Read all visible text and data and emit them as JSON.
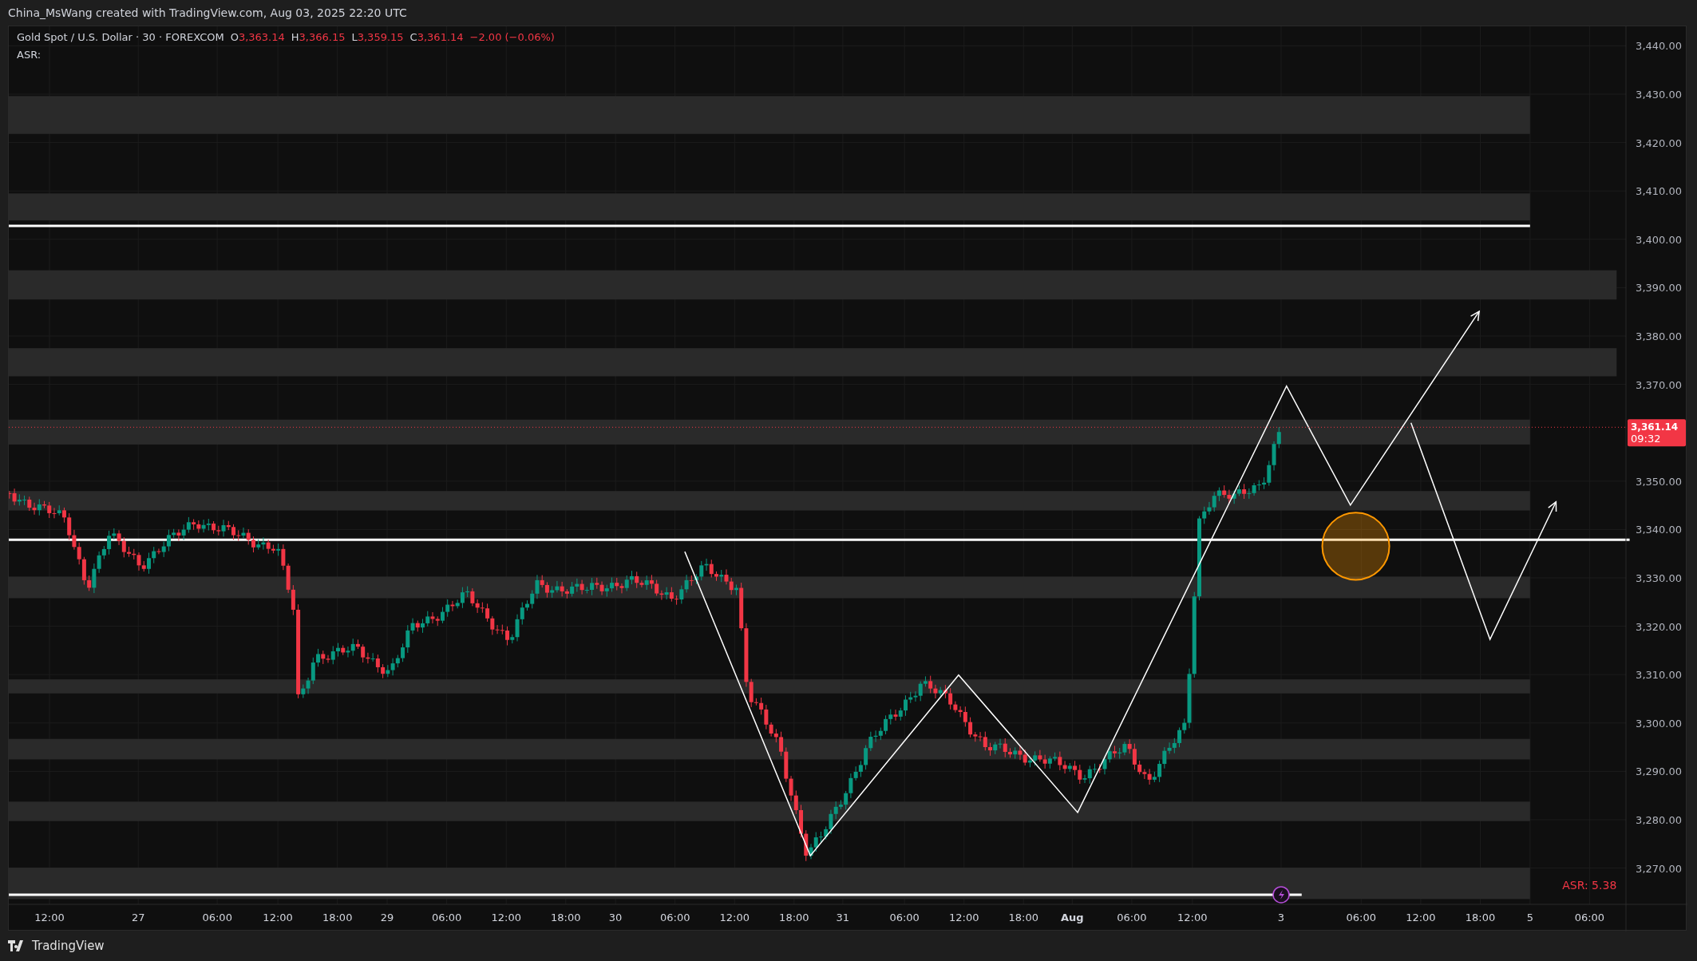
{
  "header": {
    "credit": "China_MsWang created with TradingView.com, Aug 03, 2025 22:20 UTC"
  },
  "legend": {
    "symbol": "Gold Spot / U.S. Dollar · 30 · FOREXCOM",
    "ohlc": [
      {
        "label": "O",
        "value": "3,363.14"
      },
      {
        "label": "H",
        "value": "3,366.15"
      },
      {
        "label": "L",
        "value": "3,359.15"
      },
      {
        "label": "C",
        "value": "3,361.14"
      }
    ],
    "change": "−2.00 (−0.06%)",
    "indicator": "ASR:"
  },
  "price_axis": [
    "3,440.00",
    "3,430.00",
    "3,420.00",
    "3,410.00",
    "3,400.00",
    "3,390.00",
    "3,380.00",
    "3,370.00",
    "3,350.00",
    "3,340.00",
    "3,330.00",
    "3,320.00",
    "3,310.00",
    "3,300.00",
    "3,290.00",
    "3,280.00",
    "3,270.00"
  ],
  "last_price": {
    "price": "3,361.14",
    "countdown": "09:32"
  },
  "time_axis": [
    {
      "label": "12:00",
      "emphasized": false
    },
    {
      "label": "27",
      "emphasized": false
    },
    {
      "label": "06:00",
      "emphasized": false
    },
    {
      "label": "12:00",
      "emphasized": false
    },
    {
      "label": "18:00",
      "emphasized": false
    },
    {
      "label": "29",
      "emphasized": false
    },
    {
      "label": "06:00",
      "emphasized": false
    },
    {
      "label": "12:00",
      "emphasized": false
    },
    {
      "label": "18:00",
      "emphasized": false
    },
    {
      "label": "30",
      "emphasized": false
    },
    {
      "label": "06:00",
      "emphasized": false
    },
    {
      "label": "12:00",
      "emphasized": false
    },
    {
      "label": "18:00",
      "emphasized": false
    },
    {
      "label": "31",
      "emphasized": false
    },
    {
      "label": "06:00",
      "emphasized": false
    },
    {
      "label": "12:00",
      "emphasized": false
    },
    {
      "label": "18:00",
      "emphasized": false
    },
    {
      "label": "Aug",
      "emphasized": true
    },
    {
      "label": "06:00",
      "emphasized": false
    },
    {
      "label": "12:00",
      "emphasized": false
    },
    {
      "label": "3",
      "emphasized": false
    },
    {
      "label": "06:00",
      "emphasized": false
    },
    {
      "label": "12:00",
      "emphasized": false
    },
    {
      "label": "18:00",
      "emphasized": false
    },
    {
      "label": "5",
      "emphasized": false
    },
    {
      "label": "06:00",
      "emphasized": false
    }
  ],
  "asr_label": "ASR: 5.38",
  "footer": {
    "brand": "TradingView"
  }
}
